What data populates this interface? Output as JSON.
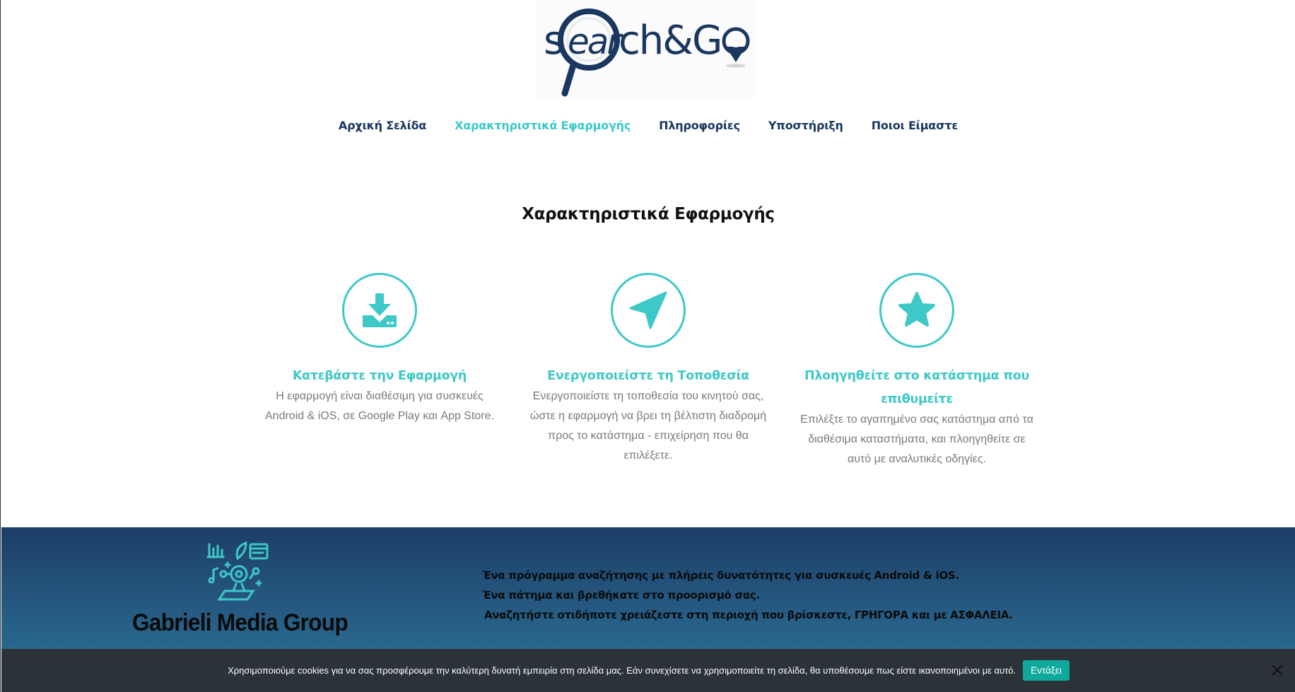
{
  "header": {
    "logo_icon": "search-and-go-logo",
    "logo_text": "Search&GO"
  },
  "nav": {
    "items": [
      {
        "label": "Αρχική Σελίδα"
      },
      {
        "label": "Χαρακτηριστικά Εφαρμογής"
      },
      {
        "label": "Πληροφορίες"
      },
      {
        "label": "Υποστήριξη"
      },
      {
        "label": "Ποιοι Είμαστε"
      }
    ],
    "active_index": 1
  },
  "main": {
    "section_title": "Χαρακτηριστικά Εφαρμογής",
    "features": [
      {
        "icon": "download-icon",
        "title": "Κατεβάστε την Εφαρμογή",
        "desc_lines": [
          "Η εφαρμογή είναι διαθέσιμη για συσκευές",
          "Android & iOS, σε Google Play και App Store."
        ]
      },
      {
        "icon": "location-arrow-icon",
        "title": "Ενεργοποιείστε τη Τοποθεσία",
        "desc_lines": [
          "Ενεργοποιείστε τη τοποθεσία του κινητού σας,",
          "ώστε η εφαρμογή να βρει τη βέλτιστη διαδρομή",
          "προς το κατάστημα - επιχείρηση που θα",
          "επιλέξετε."
        ]
      },
      {
        "icon": "star-icon",
        "title_lines": [
          "Πλοηγηθείτε στο κατάστημα που",
          "επιθυμείτε"
        ],
        "desc_lines": [
          "Επιλέξτε το αγαπημένο σας κατάστημα από τα",
          "διαθέσιμα καταστήματα, και πλοηγηθείτε σε",
          "αυτό με αναλυτικές οδηγίες."
        ]
      }
    ]
  },
  "footer": {
    "brand": "Gabrieli Media Group",
    "lines": [
      "Ένα πρόγραμμα αναζήτησης με πλήρεις δυνατότητες για συσκευές Android & iOS.",
      "Ένα πάτημα και βρεθήκατε στο προορισμό σας.",
      "Αναζητήστε οτιδήποτε χρειάζεστε στη περιοχή που βρίσκεστε, ΓΡΗΓΟΡΑ και με ΑΣΦΑΛΕΙΑ."
    ]
  },
  "cookie": {
    "text": "Χρησιμοποιούμε cookies για να σας προσφέρουμε την καλύτερη δυνατή εμπειρία στη σελίδα μας. Εάν συνεχίσετε να χρησιμοποιείτε τη σελίδα, θα υποθέσουμε πως είστε ικανοποιημένοι με αυτό.",
    "accept_label": "Εντάξει"
  },
  "colors": {
    "accent": "#3ec8c8",
    "nav_text": "#1a3760",
    "footer_top": "#1c3e66",
    "footer_bottom": "#2e7898",
    "cookie_bg": "#2b3238",
    "cookie_btn": "#0fa89c"
  }
}
